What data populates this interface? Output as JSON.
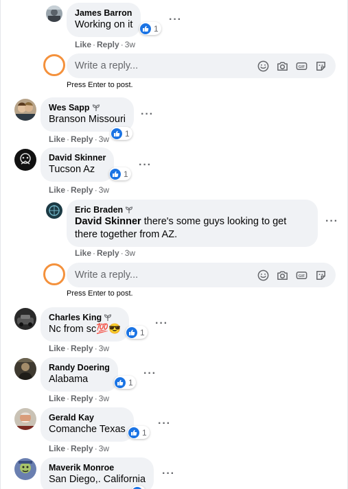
{
  "placeholders": {
    "reply": "Write a reply..."
  },
  "labels": {
    "like": "Like",
    "reply": "Reply",
    "separator": "·",
    "press_enter": "Press Enter to post."
  },
  "colors": {
    "bubble_bg": "#f0f2f5",
    "like_blue": "#1b74e4",
    "reply_avatar_ring": "#f4913c",
    "meta_text": "#65676b"
  },
  "icons": [
    "like-icon",
    "more-options-icon",
    "sprout-badge-icon",
    "emoji-icon",
    "camera-icon",
    "gif-icon",
    "sticker-icon"
  ],
  "comments": [
    {
      "id": "james",
      "author": "James Barron",
      "text": "Working on it",
      "reactions": "1",
      "time": "3w",
      "badge": false
    },
    {
      "id": "wes",
      "author": "Wes Sapp",
      "text": "Branson Missouri",
      "reactions": "1",
      "time": "3w",
      "badge": true
    },
    {
      "id": "david",
      "author": "David Skinner",
      "text": "Tucson Az",
      "reactions": "1",
      "time": "3w",
      "badge": false
    },
    {
      "id": "eric",
      "author": "Eric Braden",
      "mention": "David Skinner",
      "text": " there's some guys looking to get there together from AZ.",
      "time": "3w",
      "badge": true
    },
    {
      "id": "charles",
      "author": "Charles King",
      "text": "Nc from sc💯😎",
      "reactions": "1",
      "time": "3w",
      "badge": true
    },
    {
      "id": "randy",
      "author": "Randy Doering",
      "text": "Alabama",
      "reactions": "1",
      "time": "3w",
      "badge": false
    },
    {
      "id": "gerald",
      "author": "Gerald Kay",
      "text": "Comanche Texas",
      "reactions": "1",
      "time": "3w",
      "badge": false
    },
    {
      "id": "maverik",
      "author": "Maverik Monroe",
      "text": "San Diego,. California",
      "badge": false
    }
  ]
}
